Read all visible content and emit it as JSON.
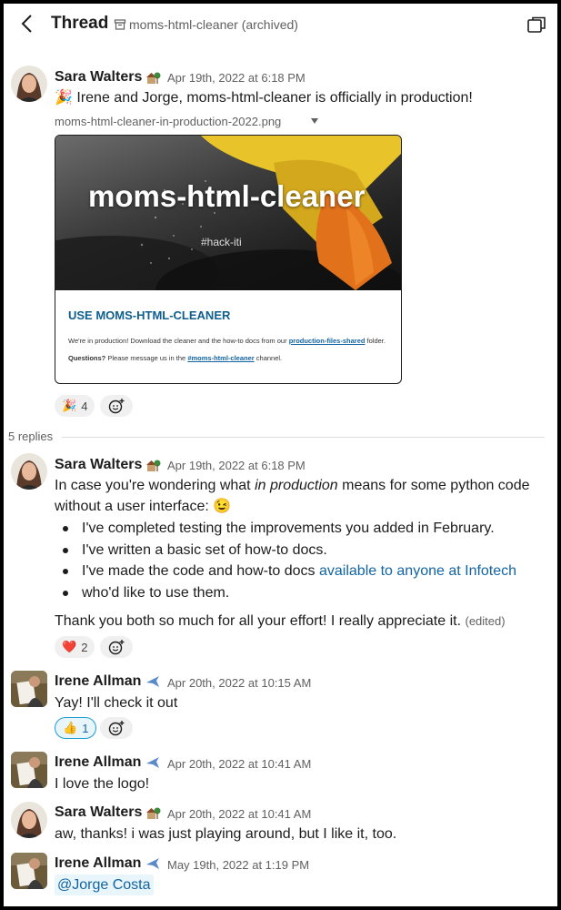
{
  "header": {
    "title": "Thread",
    "channel": "moms-html-cleaner (archived)"
  },
  "colors": {
    "link": "#1264a3",
    "mention_bg": "#e8f5fa",
    "muted": "#616061"
  },
  "messages": [
    {
      "author": "Sara Walters",
      "status_icon": "house-with-tree-icon",
      "time": "Apr 19th, 2022 at 6:18 PM",
      "text": "Irene and Jorge, moms-html-cleaner is officially in production!",
      "emoji_prefix": "🎉",
      "file": {
        "name": "moms-html-cleaner-in-production-2022.png",
        "image_title": "moms-html-cleaner",
        "image_tag": "#hack-iti",
        "heading": "USE MOMS-HTML-CLEANER",
        "body1_pre": "We're in production! Download the cleaner and the how-to docs from our ",
        "body1_link": "production-files-shared",
        "body1_post": " folder.",
        "body2_bold": "Questions?",
        "body2_pre": " Please message us in the ",
        "body2_link": "#moms-html-cleaner",
        "body2_post": " channel."
      },
      "reaction": {
        "emoji": "🎉",
        "count": "4"
      }
    },
    {
      "author": "Sara Walters",
      "status_icon": "house-with-tree-icon",
      "time": "Apr 19th, 2022 at 6:18 PM",
      "line1_pre": "In case you're wondering what ",
      "line1_em": "in production",
      "line1_post": " means for some python code",
      "line2": "without a user interface:",
      "line2_emoji": "😉",
      "bullets": [
        "I've completed testing the improvements you added in February.",
        "I've written a basic set of how-to docs."
      ],
      "bullet3_pre": "I've made the code and how-to docs ",
      "bullet3_link": "available to anyone at Infotech",
      "bullet3_cont": "who'd like to use them.",
      "closing": "Thank you both so much for all your effort! I really appreciate it.",
      "edited": "(edited)",
      "reaction": {
        "emoji": "❤️",
        "count": "2"
      }
    },
    {
      "author": "Irene Allman",
      "status_icon": "airplane-icon",
      "time": "Apr 20th, 2022 at 10:15 AM",
      "text": "Yay! I'll check it out",
      "reaction": {
        "emoji": "👍",
        "count": "1"
      }
    },
    {
      "author": "Irene Allman",
      "status_icon": "airplane-icon",
      "time": "Apr 20th, 2022 at 10:41 AM",
      "text": "I love the logo!"
    },
    {
      "author": "Sara Walters",
      "status_icon": "house-with-tree-icon",
      "time": "Apr 20th, 2022 at 10:41 AM",
      "text": "aw, thanks! i was just playing around, but I like it, too."
    },
    {
      "author": "Irene Allman",
      "status_icon": "airplane-icon",
      "time": "May 19th, 2022 at 1:19 PM",
      "mention": "@Jorge Costa"
    }
  ],
  "replies_label": "5 replies"
}
